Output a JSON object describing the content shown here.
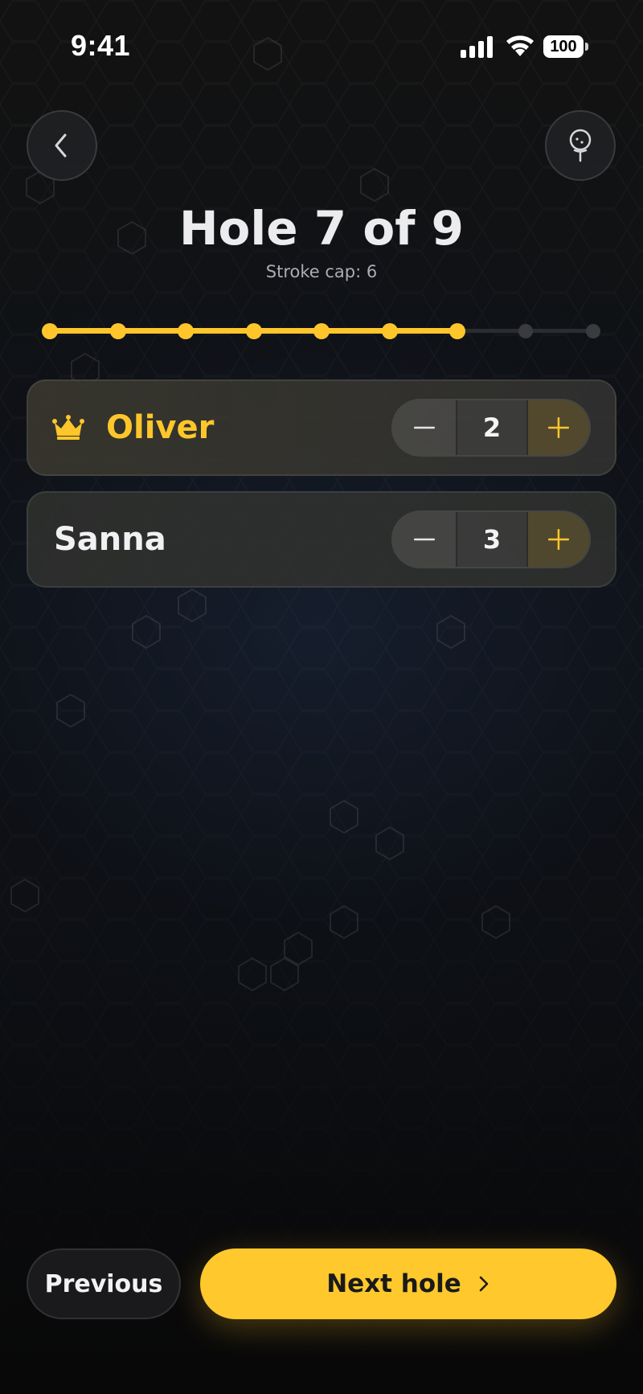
{
  "status_bar": {
    "time": "9:41",
    "battery": "100",
    "icons": [
      "signal-icon",
      "wifi-icon",
      "battery-icon"
    ]
  },
  "header": {
    "back_icon": "chevron-left-icon",
    "action_icon": "golf-ball-tee-icon",
    "title": "Hole 7 of 9",
    "subtitle": "Stroke cap: 6"
  },
  "progress": {
    "current_hole": 7,
    "total_holes": 9
  },
  "players": [
    {
      "name": "Oliver",
      "score": "2",
      "leader": true,
      "leader_icon": "crown-icon"
    },
    {
      "name": "Sanna",
      "score": "3",
      "leader": false
    }
  ],
  "stepper_icons": {
    "minus": "minus-icon",
    "plus": "plus-icon"
  },
  "footer": {
    "previous_label": "Previous",
    "next_label": "Next hole",
    "next_icon": "chevron-right-icon"
  },
  "colors": {
    "accent": "#ffc62b",
    "background": "#0d0e10",
    "card": "#323330"
  }
}
